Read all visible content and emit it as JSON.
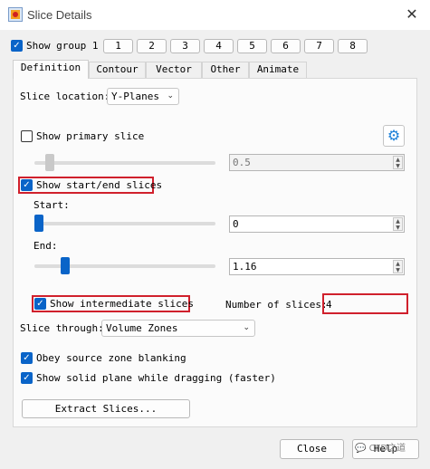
{
  "window": {
    "title": "Slice Details",
    "close_glyph": "✕"
  },
  "group": {
    "show_group_label": "Show group 1",
    "show_group_checked": true,
    "buttons": [
      "1",
      "2",
      "3",
      "4",
      "5",
      "6",
      "7",
      "8"
    ]
  },
  "tabs": [
    "Definition",
    "Contour",
    "Vector",
    "Other",
    "Animate"
  ],
  "active_tab": "Definition",
  "definition": {
    "slice_location_label": "Slice location:",
    "slice_location_value": "Y-Planes",
    "show_primary_slice_label": "Show primary slice",
    "show_primary_slice_checked": false,
    "primary_value": "0.5",
    "show_start_end_label": "Show start/end slices",
    "show_start_end_checked": true,
    "start_label": "Start:",
    "start_value": "0",
    "end_label": "End:",
    "end_value": "1.16",
    "show_intermediate_label": "Show intermediate slices",
    "show_intermediate_checked": true,
    "number_of_slices_label": "Number of slices:",
    "number_of_slices_value": "4",
    "slice_through_label": "Slice through:",
    "slice_through_value": "Volume Zones",
    "obey_blanking_label": "Obey source zone blanking",
    "obey_blanking_checked": true,
    "show_solid_plane_label": "Show solid plane while dragging (faster)",
    "show_solid_plane_checked": true,
    "extract_button_label": "Extract Slices..."
  },
  "footer": {
    "close_label": "Close",
    "help_label": "Help"
  },
  "watermark": "CFD之道",
  "colors": {
    "accent": "#0a64c8",
    "highlight_box": "#d0202c"
  },
  "icons": {
    "app": "tecplot-app-icon",
    "settings": "gear-icon",
    "check": "✓",
    "chevron": "⌄"
  }
}
